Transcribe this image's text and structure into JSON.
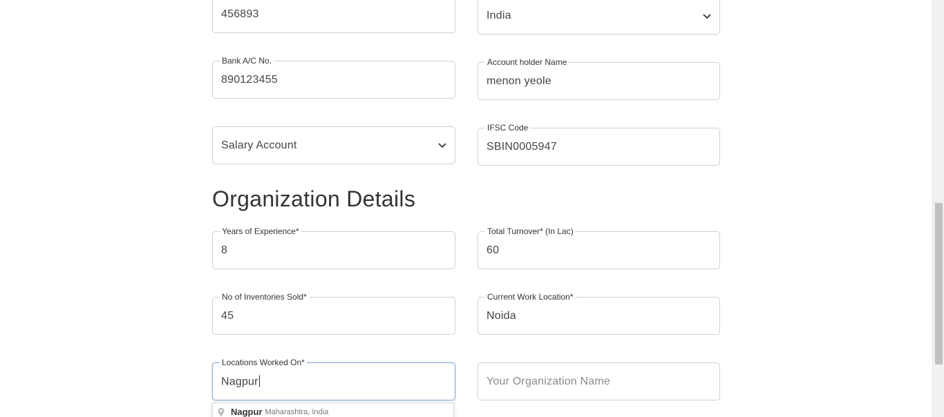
{
  "bank": {
    "pincode": {
      "value": "456893"
    },
    "country": {
      "value": "India"
    },
    "account_no": {
      "label": "Bank A/C No.",
      "value": "890123455"
    },
    "account_holder": {
      "label": "Account holder Name",
      "value": "menon yeole"
    },
    "account_type": {
      "value": "Salary Account"
    },
    "ifsc": {
      "label": "IFSC Code",
      "value": "SBIN0005947"
    }
  },
  "organization": {
    "title": "Organization Details",
    "experience": {
      "label": "Years of Experience*",
      "value": "8"
    },
    "turnover": {
      "label": "Total Turnover* (In Lac)",
      "value": "60"
    },
    "inventories": {
      "label": "No of Inventories Sold*",
      "value": "45"
    },
    "work_location": {
      "label": "Current Work Location*",
      "value": "Noida"
    },
    "locations_worked": {
      "label": "Locations Worked On*",
      "value": "Nagpur"
    },
    "org_name": {
      "placeholder": "Your Organization Name"
    }
  },
  "autocomplete": {
    "suggestions": [
      {
        "main": "Nagpur",
        "secondary": "Maharashtra, India",
        "icon": "map-pin-icon"
      }
    ]
  },
  "colors": {
    "border": "#cfcfcf",
    "focus_border": "#8fb3d6",
    "text": "#333333",
    "placeholder": "#8a8a8a"
  }
}
